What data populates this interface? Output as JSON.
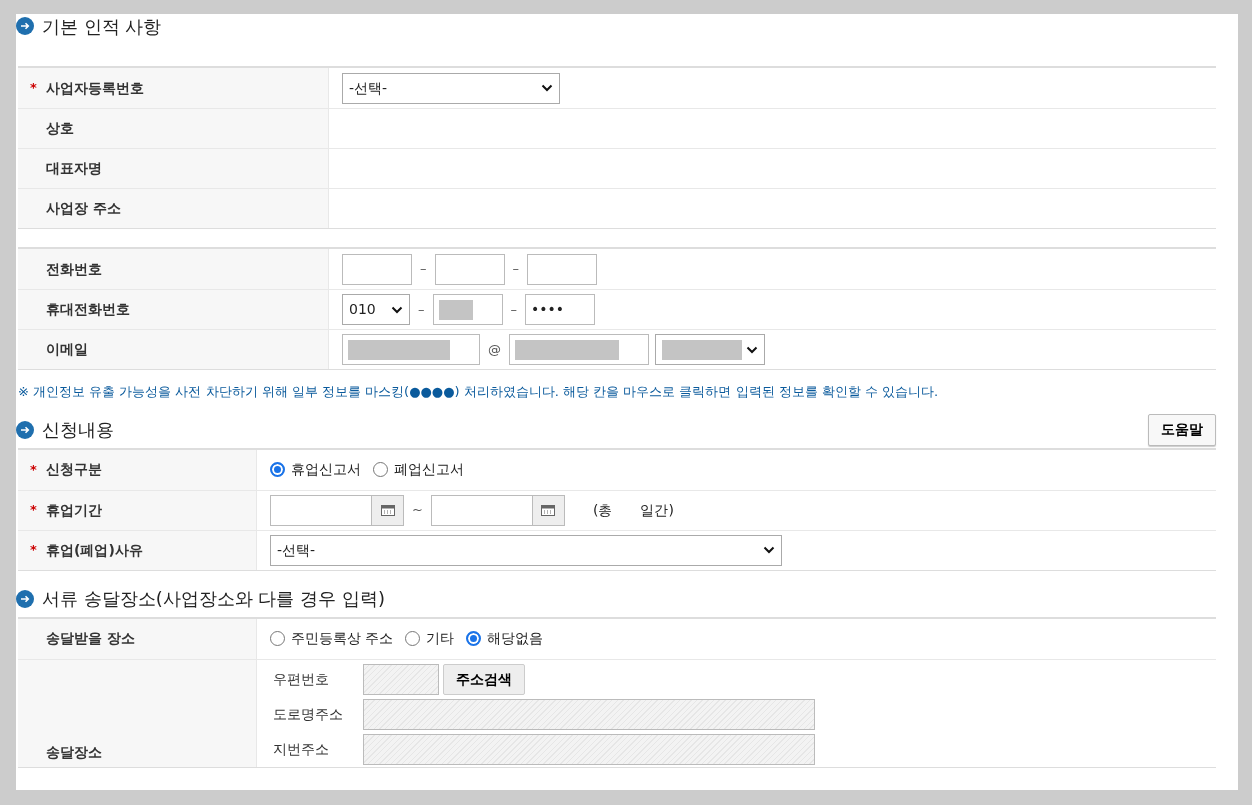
{
  "sections": [
    {
      "title": "기본 인적 사항",
      "tables": [
        [
          {
            "kind": "select",
            "label": "사업자등록번호",
            "required_mark": "*",
            "value": "-선택-"
          },
          {
            "kind": "text",
            "label": "상호"
          },
          {
            "kind": "text",
            "label": "대표자명"
          },
          {
            "kind": "text",
            "label": "사업장 주소"
          }
        ],
        [
          {
            "kind": "fields",
            "label": "전화번호",
            "fields": [
              {
                "kind": "input"
              },
              {
                "kind": "input",
                "prefix": "–"
              },
              {
                "kind": "input",
                "prefix": "–"
              }
            ]
          },
          {
            "kind": "fields",
            "label": "휴대전화번호",
            "fields": [
              {
                "kind": "select",
                "value": "010"
              },
              {
                "kind": "input",
                "prefix": "–",
                "masked": true
              },
              {
                "kind": "input",
                "prefix": "–",
                "value": "••••"
              }
            ]
          },
          {
            "kind": "fields",
            "label": "이메일",
            "fields": [
              {
                "kind": "input",
                "masked": true
              },
              {
                "kind": "input",
                "prefix": "@",
                "masked": true
              },
              {
                "kind": "select",
                "masked": true
              }
            ]
          }
        ]
      ],
      "notice": "※ 개인정보 유출 가능성을 사전 차단하기 위해 일부 정보를 마스킹(●●●●) 처리하였습니다. 해당 칸을 마우스로 클릭하면 입력된 정보를 확인할 수 있습니다."
    },
    {
      "title": "신청내용",
      "help_button": "도움말",
      "tables": [
        [
          {
            "kind": "radio",
            "label": "신청구분",
            "required_mark": "*",
            "options": [
              {
                "label": "휴업신고서",
                "selected": true
              },
              {
                "label": "폐업신고서",
                "selected": false
              }
            ]
          },
          {
            "kind": "daterange",
            "label": "휴업기간",
            "required_mark": "*",
            "separator": "~",
            "total_prefix": "(총",
            "total_suffix": "일간)"
          },
          {
            "kind": "select",
            "label": "휴업(폐업)사유",
            "required_mark": "*",
            "value": "-선택-",
            "wide": true
          }
        ]
      ]
    },
    {
      "title": "서류 송달장소(사업장소와 다를 경우 입력)",
      "tables": [
        [
          {
            "kind": "radio",
            "label": "송달받을 장소",
            "options": [
              {
                "label": "주민등록상 주소",
                "selected": false
              },
              {
                "label": "기타",
                "selected": false
              },
              {
                "label": "해당없음",
                "selected": true
              }
            ]
          },
          {
            "kind": "address",
            "label": "송달장소",
            "lines": [
              {
                "label": "우편번호",
                "button": "주소검색",
                "disabled": true
              },
              {
                "label": "도로명주소",
                "disabled": true
              },
              {
                "label": "지번주소",
                "disabled": true
              }
            ]
          }
        ]
      ]
    }
  ]
}
